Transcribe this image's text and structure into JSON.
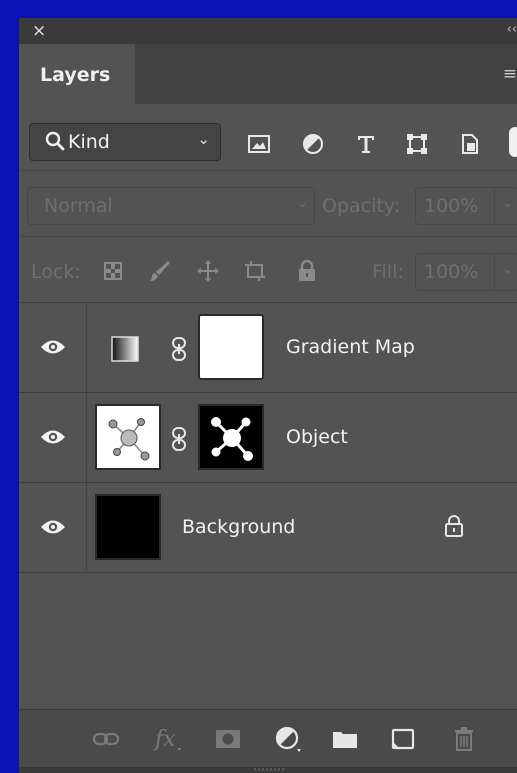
{
  "window": {
    "close_symbol": "×",
    "collapse_symbol": "‹‹"
  },
  "tabs": [
    {
      "label": "Layers",
      "active": true
    }
  ],
  "panel_menu_icon": "≡",
  "filter": {
    "kind_label": "Kind",
    "icons": [
      "image-filter-icon",
      "adjustment-filter-icon",
      "type-filter-icon",
      "shape-filter-icon",
      "smart-object-filter-icon"
    ]
  },
  "blend": {
    "mode": "Normal",
    "opacity_label": "Opacity:",
    "opacity_value": "100%"
  },
  "lock": {
    "label": "Lock:",
    "fill_label": "Fill:",
    "fill_value": "100%"
  },
  "layers": [
    {
      "name": "Gradient Map",
      "visible": true,
      "type": "adjustment"
    },
    {
      "name": "Object",
      "visible": true,
      "type": "image-with-mask"
    },
    {
      "name": "Background",
      "visible": true,
      "type": "background",
      "locked": true
    }
  ],
  "bottom_icons": [
    "link-layers-icon",
    "fx-icon",
    "add-mask-icon",
    "new-adjustment-icon",
    "new-group-icon",
    "new-layer-icon",
    "delete-icon"
  ],
  "colors": {
    "panel_bg": "#535353",
    "frame_bg": "#0a12b8"
  }
}
